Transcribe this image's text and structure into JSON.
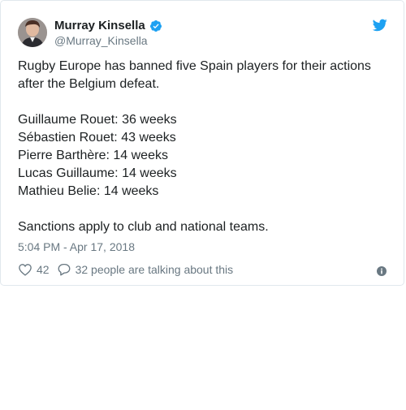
{
  "author": {
    "name": "Murray Kinsella",
    "handle": "@Murray_Kinsella",
    "verified": true
  },
  "tweet": {
    "paragraphs": [
      [
        "Rugby Europe has banned five Spain players for their actions after the Belgium defeat."
      ],
      [
        "Guillaume Rouet: 36 weeks",
        "Sébastien Rouet: 43 weeks",
        "Pierre Barthère: 14 weeks",
        "Lucas Guillaume: 14 weeks",
        "Mathieu Belie: 14 weeks"
      ],
      [
        "Sanctions apply to club and national teams."
      ]
    ],
    "timestamp": "5:04 PM - Apr 17, 2018"
  },
  "actions": {
    "likes": "42",
    "talking": "32 people are talking about this"
  },
  "icons": {
    "verified": "verified-badge-icon",
    "brand": "twitter-bird-icon",
    "like": "heart-icon",
    "reply": "speech-bubble-icon",
    "info": "info-icon"
  },
  "colors": {
    "brand_blue": "#1da1f2",
    "text": "#1c2022",
    "muted": "#697882",
    "border": "#e1e8ed"
  }
}
